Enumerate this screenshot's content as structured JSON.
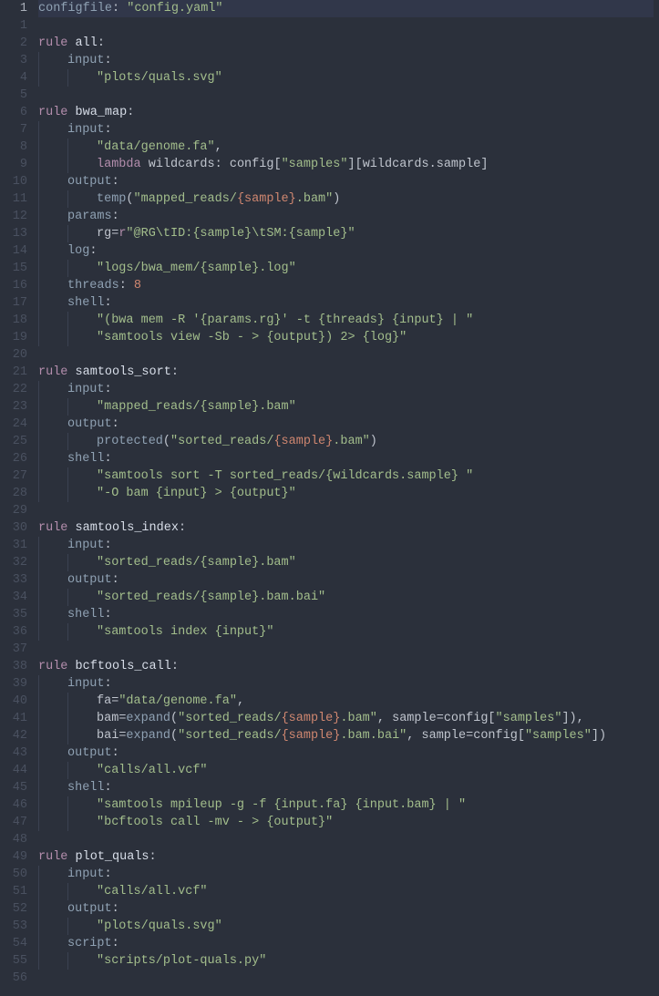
{
  "currentLine": 1,
  "lines": [
    {
      "n": 1,
      "indent": 0,
      "segs": [
        {
          "c": "tok-def",
          "t": "configfile"
        },
        {
          "c": "tok-op",
          "t": ": "
        },
        {
          "c": "tok-str",
          "t": "\"config.yaml\""
        }
      ]
    },
    {
      "n": 1,
      "indent": 0,
      "segs": []
    },
    {
      "n": 2,
      "indent": 0,
      "segs": [
        {
          "c": "tok-kw",
          "t": "rule"
        },
        {
          "c": "",
          "t": " "
        },
        {
          "c": "tok-name",
          "t": "all"
        },
        {
          "c": "tok-op",
          "t": ":"
        }
      ]
    },
    {
      "n": 3,
      "indent": 1,
      "segs": [
        {
          "c": "tok-def",
          "t": "input"
        },
        {
          "c": "tok-op",
          "t": ":"
        }
      ]
    },
    {
      "n": 4,
      "indent": 2,
      "segs": [
        {
          "c": "tok-str",
          "t": "\"plots/quals.svg\""
        }
      ]
    },
    {
      "n": 5,
      "indent": 0,
      "segs": []
    },
    {
      "n": 6,
      "indent": 0,
      "segs": [
        {
          "c": "tok-kw",
          "t": "rule"
        },
        {
          "c": "",
          "t": " "
        },
        {
          "c": "tok-name",
          "t": "bwa_map"
        },
        {
          "c": "tok-op",
          "t": ":"
        }
      ]
    },
    {
      "n": 7,
      "indent": 1,
      "segs": [
        {
          "c": "tok-def",
          "t": "input"
        },
        {
          "c": "tok-op",
          "t": ":"
        }
      ]
    },
    {
      "n": 8,
      "indent": 2,
      "segs": [
        {
          "c": "tok-str",
          "t": "\"data/genome.fa\""
        },
        {
          "c": "tok-op",
          "t": ","
        }
      ]
    },
    {
      "n": 9,
      "indent": 2,
      "segs": [
        {
          "c": "tok-kw",
          "t": "lambda"
        },
        {
          "c": "",
          "t": " "
        },
        {
          "c": "tok-id",
          "t": "wildcards"
        },
        {
          "c": "tok-op",
          "t": ": "
        },
        {
          "c": "tok-id",
          "t": "config"
        },
        {
          "c": "tok-op",
          "t": "["
        },
        {
          "c": "tok-str",
          "t": "\"samples\""
        },
        {
          "c": "tok-op",
          "t": "]["
        },
        {
          "c": "tok-id",
          "t": "wildcards"
        },
        {
          "c": "tok-op",
          "t": "."
        },
        {
          "c": "tok-id",
          "t": "sample"
        },
        {
          "c": "tok-op",
          "t": "]"
        }
      ]
    },
    {
      "n": 10,
      "indent": 1,
      "segs": [
        {
          "c": "tok-def",
          "t": "output"
        },
        {
          "c": "tok-op",
          "t": ":"
        }
      ]
    },
    {
      "n": 11,
      "indent": 2,
      "segs": [
        {
          "c": "tok-fn",
          "t": "temp"
        },
        {
          "c": "tok-op",
          "t": "("
        },
        {
          "c": "tok-str",
          "t": "\"mapped_reads/"
        },
        {
          "c": "tok-fmt",
          "t": "{sample}"
        },
        {
          "c": "tok-str",
          "t": ".bam\""
        },
        {
          "c": "tok-op",
          "t": ")"
        }
      ]
    },
    {
      "n": 12,
      "indent": 1,
      "segs": [
        {
          "c": "tok-def",
          "t": "params"
        },
        {
          "c": "tok-op",
          "t": ":"
        }
      ]
    },
    {
      "n": 13,
      "indent": 2,
      "segs": [
        {
          "c": "tok-id",
          "t": "rg"
        },
        {
          "c": "tok-op",
          "t": "="
        },
        {
          "c": "tok-kw",
          "t": "r"
        },
        {
          "c": "tok-str",
          "t": "\"@RG\\tID:{sample}\\tSM:{sample}\""
        }
      ]
    },
    {
      "n": 14,
      "indent": 1,
      "segs": [
        {
          "c": "tok-def",
          "t": "log"
        },
        {
          "c": "tok-op",
          "t": ":"
        }
      ]
    },
    {
      "n": 15,
      "indent": 2,
      "segs": [
        {
          "c": "tok-str",
          "t": "\"logs/bwa_mem/{sample}.log\""
        }
      ]
    },
    {
      "n": 16,
      "indent": 1,
      "segs": [
        {
          "c": "tok-def",
          "t": "threads"
        },
        {
          "c": "tok-op",
          "t": ": "
        },
        {
          "c": "tok-num",
          "t": "8"
        }
      ]
    },
    {
      "n": 17,
      "indent": 1,
      "segs": [
        {
          "c": "tok-def",
          "t": "shell"
        },
        {
          "c": "tok-op",
          "t": ":"
        }
      ]
    },
    {
      "n": 18,
      "indent": 2,
      "segs": [
        {
          "c": "tok-str",
          "t": "\"(bwa mem -R '{params.rg}' -t {threads} {input} | \""
        }
      ]
    },
    {
      "n": 19,
      "indent": 2,
      "segs": [
        {
          "c": "tok-str",
          "t": "\"samtools view -Sb - > {output}) 2> {log}\""
        }
      ]
    },
    {
      "n": 20,
      "indent": 0,
      "segs": []
    },
    {
      "n": 21,
      "indent": 0,
      "segs": [
        {
          "c": "tok-kw",
          "t": "rule"
        },
        {
          "c": "",
          "t": " "
        },
        {
          "c": "tok-name",
          "t": "samtools_sort"
        },
        {
          "c": "tok-op",
          "t": ":"
        }
      ]
    },
    {
      "n": 22,
      "indent": 1,
      "segs": [
        {
          "c": "tok-def",
          "t": "input"
        },
        {
          "c": "tok-op",
          "t": ":"
        }
      ]
    },
    {
      "n": 23,
      "indent": 2,
      "segs": [
        {
          "c": "tok-str",
          "t": "\"mapped_reads/{sample}.bam\""
        }
      ]
    },
    {
      "n": 24,
      "indent": 1,
      "segs": [
        {
          "c": "tok-def",
          "t": "output"
        },
        {
          "c": "tok-op",
          "t": ":"
        }
      ]
    },
    {
      "n": 25,
      "indent": 2,
      "segs": [
        {
          "c": "tok-fn",
          "t": "protected"
        },
        {
          "c": "tok-op",
          "t": "("
        },
        {
          "c": "tok-str",
          "t": "\"sorted_reads/"
        },
        {
          "c": "tok-fmt",
          "t": "{sample}"
        },
        {
          "c": "tok-str",
          "t": ".bam\""
        },
        {
          "c": "tok-op",
          "t": ")"
        }
      ]
    },
    {
      "n": 26,
      "indent": 1,
      "segs": [
        {
          "c": "tok-def",
          "t": "shell"
        },
        {
          "c": "tok-op",
          "t": ":"
        }
      ]
    },
    {
      "n": 27,
      "indent": 2,
      "segs": [
        {
          "c": "tok-str",
          "t": "\"samtools sort -T sorted_reads/{wildcards.sample} \""
        }
      ]
    },
    {
      "n": 28,
      "indent": 2,
      "segs": [
        {
          "c": "tok-str",
          "t": "\"-O bam {input} > {output}\""
        }
      ]
    },
    {
      "n": 29,
      "indent": 0,
      "segs": []
    },
    {
      "n": 30,
      "indent": 0,
      "segs": [
        {
          "c": "tok-kw",
          "t": "rule"
        },
        {
          "c": "",
          "t": " "
        },
        {
          "c": "tok-name",
          "t": "samtools_index"
        },
        {
          "c": "tok-op",
          "t": ":"
        }
      ]
    },
    {
      "n": 31,
      "indent": 1,
      "segs": [
        {
          "c": "tok-def",
          "t": "input"
        },
        {
          "c": "tok-op",
          "t": ":"
        }
      ]
    },
    {
      "n": 32,
      "indent": 2,
      "segs": [
        {
          "c": "tok-str",
          "t": "\"sorted_reads/{sample}.bam\""
        }
      ]
    },
    {
      "n": 33,
      "indent": 1,
      "segs": [
        {
          "c": "tok-def",
          "t": "output"
        },
        {
          "c": "tok-op",
          "t": ":"
        }
      ]
    },
    {
      "n": 34,
      "indent": 2,
      "segs": [
        {
          "c": "tok-str",
          "t": "\"sorted_reads/{sample}.bam.bai\""
        }
      ]
    },
    {
      "n": 35,
      "indent": 1,
      "segs": [
        {
          "c": "tok-def",
          "t": "shell"
        },
        {
          "c": "tok-op",
          "t": ":"
        }
      ]
    },
    {
      "n": 36,
      "indent": 2,
      "segs": [
        {
          "c": "tok-str",
          "t": "\"samtools index {input}\""
        }
      ]
    },
    {
      "n": 37,
      "indent": 0,
      "segs": []
    },
    {
      "n": 38,
      "indent": 0,
      "segs": [
        {
          "c": "tok-kw",
          "t": "rule"
        },
        {
          "c": "",
          "t": " "
        },
        {
          "c": "tok-name",
          "t": "bcftools_call"
        },
        {
          "c": "tok-op",
          "t": ":"
        }
      ]
    },
    {
      "n": 39,
      "indent": 1,
      "segs": [
        {
          "c": "tok-def",
          "t": "input"
        },
        {
          "c": "tok-op",
          "t": ":"
        }
      ]
    },
    {
      "n": 40,
      "indent": 2,
      "segs": [
        {
          "c": "tok-id",
          "t": "fa"
        },
        {
          "c": "tok-op",
          "t": "="
        },
        {
          "c": "tok-str",
          "t": "\"data/genome.fa\""
        },
        {
          "c": "tok-op",
          "t": ","
        }
      ]
    },
    {
      "n": 41,
      "indent": 2,
      "segs": [
        {
          "c": "tok-id",
          "t": "bam"
        },
        {
          "c": "tok-op",
          "t": "="
        },
        {
          "c": "tok-fn",
          "t": "expand"
        },
        {
          "c": "tok-op",
          "t": "("
        },
        {
          "c": "tok-str",
          "t": "\"sorted_reads/"
        },
        {
          "c": "tok-fmt",
          "t": "{sample}"
        },
        {
          "c": "tok-str",
          "t": ".bam\""
        },
        {
          "c": "tok-op",
          "t": ", "
        },
        {
          "c": "tok-id",
          "t": "sample"
        },
        {
          "c": "tok-op",
          "t": "="
        },
        {
          "c": "tok-id",
          "t": "config"
        },
        {
          "c": "tok-op",
          "t": "["
        },
        {
          "c": "tok-str",
          "t": "\"samples\""
        },
        {
          "c": "tok-op",
          "t": "]),"
        }
      ]
    },
    {
      "n": 42,
      "indent": 2,
      "segs": [
        {
          "c": "tok-id",
          "t": "bai"
        },
        {
          "c": "tok-op",
          "t": "="
        },
        {
          "c": "tok-fn",
          "t": "expand"
        },
        {
          "c": "tok-op",
          "t": "("
        },
        {
          "c": "tok-str",
          "t": "\"sorted_reads/"
        },
        {
          "c": "tok-fmt",
          "t": "{sample}"
        },
        {
          "c": "tok-str",
          "t": ".bam.bai\""
        },
        {
          "c": "tok-op",
          "t": ", "
        },
        {
          "c": "tok-id",
          "t": "sample"
        },
        {
          "c": "tok-op",
          "t": "="
        },
        {
          "c": "tok-id",
          "t": "config"
        },
        {
          "c": "tok-op",
          "t": "["
        },
        {
          "c": "tok-str",
          "t": "\"samples\""
        },
        {
          "c": "tok-op",
          "t": "])"
        }
      ]
    },
    {
      "n": 43,
      "indent": 1,
      "segs": [
        {
          "c": "tok-def",
          "t": "output"
        },
        {
          "c": "tok-op",
          "t": ":"
        }
      ]
    },
    {
      "n": 44,
      "indent": 2,
      "segs": [
        {
          "c": "tok-str",
          "t": "\"calls/all.vcf\""
        }
      ]
    },
    {
      "n": 45,
      "indent": 1,
      "segs": [
        {
          "c": "tok-def",
          "t": "shell"
        },
        {
          "c": "tok-op",
          "t": ":"
        }
      ]
    },
    {
      "n": 46,
      "indent": 2,
      "segs": [
        {
          "c": "tok-str",
          "t": "\"samtools mpileup -g -f {input.fa} {input.bam} | \""
        }
      ]
    },
    {
      "n": 47,
      "indent": 2,
      "segs": [
        {
          "c": "tok-str",
          "t": "\"bcftools call -mv - > {output}\""
        }
      ]
    },
    {
      "n": 48,
      "indent": 0,
      "segs": []
    },
    {
      "n": 49,
      "indent": 0,
      "segs": [
        {
          "c": "tok-kw",
          "t": "rule"
        },
        {
          "c": "",
          "t": " "
        },
        {
          "c": "tok-name",
          "t": "plot_quals"
        },
        {
          "c": "tok-op",
          "t": ":"
        }
      ]
    },
    {
      "n": 50,
      "indent": 1,
      "segs": [
        {
          "c": "tok-def",
          "t": "input"
        },
        {
          "c": "tok-op",
          "t": ":"
        }
      ]
    },
    {
      "n": 51,
      "indent": 2,
      "segs": [
        {
          "c": "tok-str",
          "t": "\"calls/all.vcf\""
        }
      ]
    },
    {
      "n": 52,
      "indent": 1,
      "segs": [
        {
          "c": "tok-def",
          "t": "output"
        },
        {
          "c": "tok-op",
          "t": ":"
        }
      ]
    },
    {
      "n": 53,
      "indent": 2,
      "segs": [
        {
          "c": "tok-str",
          "t": "\"plots/quals.svg\""
        }
      ]
    },
    {
      "n": 54,
      "indent": 1,
      "segs": [
        {
          "c": "tok-def",
          "t": "script"
        },
        {
          "c": "tok-op",
          "t": ":"
        }
      ]
    },
    {
      "n": 55,
      "indent": 2,
      "segs": [
        {
          "c": "tok-str",
          "t": "\"scripts/plot-quals.py\""
        }
      ]
    },
    {
      "n": 56,
      "indent": 0,
      "segs": []
    }
  ]
}
